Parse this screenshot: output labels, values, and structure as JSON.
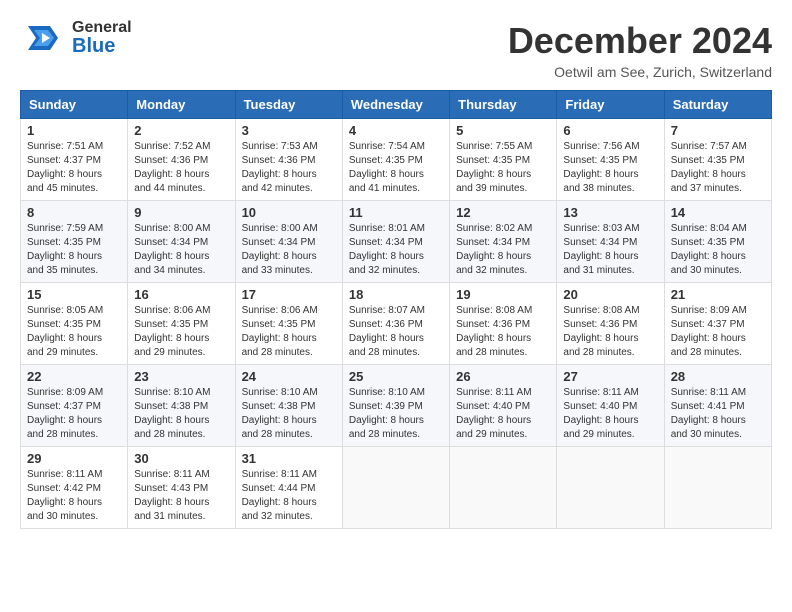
{
  "logo": {
    "general": "General",
    "blue": "Blue"
  },
  "title": "December 2024",
  "location": "Oetwil am See, Zurich, Switzerland",
  "weekdays": [
    "Sunday",
    "Monday",
    "Tuesday",
    "Wednesday",
    "Thursday",
    "Friday",
    "Saturday"
  ],
  "weeks": [
    [
      {
        "day": "1",
        "sunrise": "Sunrise: 7:51 AM",
        "sunset": "Sunset: 4:37 PM",
        "daylight": "Daylight: 8 hours and 45 minutes."
      },
      {
        "day": "2",
        "sunrise": "Sunrise: 7:52 AM",
        "sunset": "Sunset: 4:36 PM",
        "daylight": "Daylight: 8 hours and 44 minutes."
      },
      {
        "day": "3",
        "sunrise": "Sunrise: 7:53 AM",
        "sunset": "Sunset: 4:36 PM",
        "daylight": "Daylight: 8 hours and 42 minutes."
      },
      {
        "day": "4",
        "sunrise": "Sunrise: 7:54 AM",
        "sunset": "Sunset: 4:35 PM",
        "daylight": "Daylight: 8 hours and 41 minutes."
      },
      {
        "day": "5",
        "sunrise": "Sunrise: 7:55 AM",
        "sunset": "Sunset: 4:35 PM",
        "daylight": "Daylight: 8 hours and 39 minutes."
      },
      {
        "day": "6",
        "sunrise": "Sunrise: 7:56 AM",
        "sunset": "Sunset: 4:35 PM",
        "daylight": "Daylight: 8 hours and 38 minutes."
      },
      {
        "day": "7",
        "sunrise": "Sunrise: 7:57 AM",
        "sunset": "Sunset: 4:35 PM",
        "daylight": "Daylight: 8 hours and 37 minutes."
      }
    ],
    [
      {
        "day": "8",
        "sunrise": "Sunrise: 7:59 AM",
        "sunset": "Sunset: 4:35 PM",
        "daylight": "Daylight: 8 hours and 35 minutes."
      },
      {
        "day": "9",
        "sunrise": "Sunrise: 8:00 AM",
        "sunset": "Sunset: 4:34 PM",
        "daylight": "Daylight: 8 hours and 34 minutes."
      },
      {
        "day": "10",
        "sunrise": "Sunrise: 8:00 AM",
        "sunset": "Sunset: 4:34 PM",
        "daylight": "Daylight: 8 hours and 33 minutes."
      },
      {
        "day": "11",
        "sunrise": "Sunrise: 8:01 AM",
        "sunset": "Sunset: 4:34 PM",
        "daylight": "Daylight: 8 hours and 32 minutes."
      },
      {
        "day": "12",
        "sunrise": "Sunrise: 8:02 AM",
        "sunset": "Sunset: 4:34 PM",
        "daylight": "Daylight: 8 hours and 32 minutes."
      },
      {
        "day": "13",
        "sunrise": "Sunrise: 8:03 AM",
        "sunset": "Sunset: 4:34 PM",
        "daylight": "Daylight: 8 hours and 31 minutes."
      },
      {
        "day": "14",
        "sunrise": "Sunrise: 8:04 AM",
        "sunset": "Sunset: 4:35 PM",
        "daylight": "Daylight: 8 hours and 30 minutes."
      }
    ],
    [
      {
        "day": "15",
        "sunrise": "Sunrise: 8:05 AM",
        "sunset": "Sunset: 4:35 PM",
        "daylight": "Daylight: 8 hours and 29 minutes."
      },
      {
        "day": "16",
        "sunrise": "Sunrise: 8:06 AM",
        "sunset": "Sunset: 4:35 PM",
        "daylight": "Daylight: 8 hours and 29 minutes."
      },
      {
        "day": "17",
        "sunrise": "Sunrise: 8:06 AM",
        "sunset": "Sunset: 4:35 PM",
        "daylight": "Daylight: 8 hours and 28 minutes."
      },
      {
        "day": "18",
        "sunrise": "Sunrise: 8:07 AM",
        "sunset": "Sunset: 4:36 PM",
        "daylight": "Daylight: 8 hours and 28 minutes."
      },
      {
        "day": "19",
        "sunrise": "Sunrise: 8:08 AM",
        "sunset": "Sunset: 4:36 PM",
        "daylight": "Daylight: 8 hours and 28 minutes."
      },
      {
        "day": "20",
        "sunrise": "Sunrise: 8:08 AM",
        "sunset": "Sunset: 4:36 PM",
        "daylight": "Daylight: 8 hours and 28 minutes."
      },
      {
        "day": "21",
        "sunrise": "Sunrise: 8:09 AM",
        "sunset": "Sunset: 4:37 PM",
        "daylight": "Daylight: 8 hours and 28 minutes."
      }
    ],
    [
      {
        "day": "22",
        "sunrise": "Sunrise: 8:09 AM",
        "sunset": "Sunset: 4:37 PM",
        "daylight": "Daylight: 8 hours and 28 minutes."
      },
      {
        "day": "23",
        "sunrise": "Sunrise: 8:10 AM",
        "sunset": "Sunset: 4:38 PM",
        "daylight": "Daylight: 8 hours and 28 minutes."
      },
      {
        "day": "24",
        "sunrise": "Sunrise: 8:10 AM",
        "sunset": "Sunset: 4:38 PM",
        "daylight": "Daylight: 8 hours and 28 minutes."
      },
      {
        "day": "25",
        "sunrise": "Sunrise: 8:10 AM",
        "sunset": "Sunset: 4:39 PM",
        "daylight": "Daylight: 8 hours and 28 minutes."
      },
      {
        "day": "26",
        "sunrise": "Sunrise: 8:11 AM",
        "sunset": "Sunset: 4:40 PM",
        "daylight": "Daylight: 8 hours and 29 minutes."
      },
      {
        "day": "27",
        "sunrise": "Sunrise: 8:11 AM",
        "sunset": "Sunset: 4:40 PM",
        "daylight": "Daylight: 8 hours and 29 minutes."
      },
      {
        "day": "28",
        "sunrise": "Sunrise: 8:11 AM",
        "sunset": "Sunset: 4:41 PM",
        "daylight": "Daylight: 8 hours and 30 minutes."
      }
    ],
    [
      {
        "day": "29",
        "sunrise": "Sunrise: 8:11 AM",
        "sunset": "Sunset: 4:42 PM",
        "daylight": "Daylight: 8 hours and 30 minutes."
      },
      {
        "day": "30",
        "sunrise": "Sunrise: 8:11 AM",
        "sunset": "Sunset: 4:43 PM",
        "daylight": "Daylight: 8 hours and 31 minutes."
      },
      {
        "day": "31",
        "sunrise": "Sunrise: 8:11 AM",
        "sunset": "Sunset: 4:44 PM",
        "daylight": "Daylight: 8 hours and 32 minutes."
      },
      null,
      null,
      null,
      null
    ]
  ]
}
